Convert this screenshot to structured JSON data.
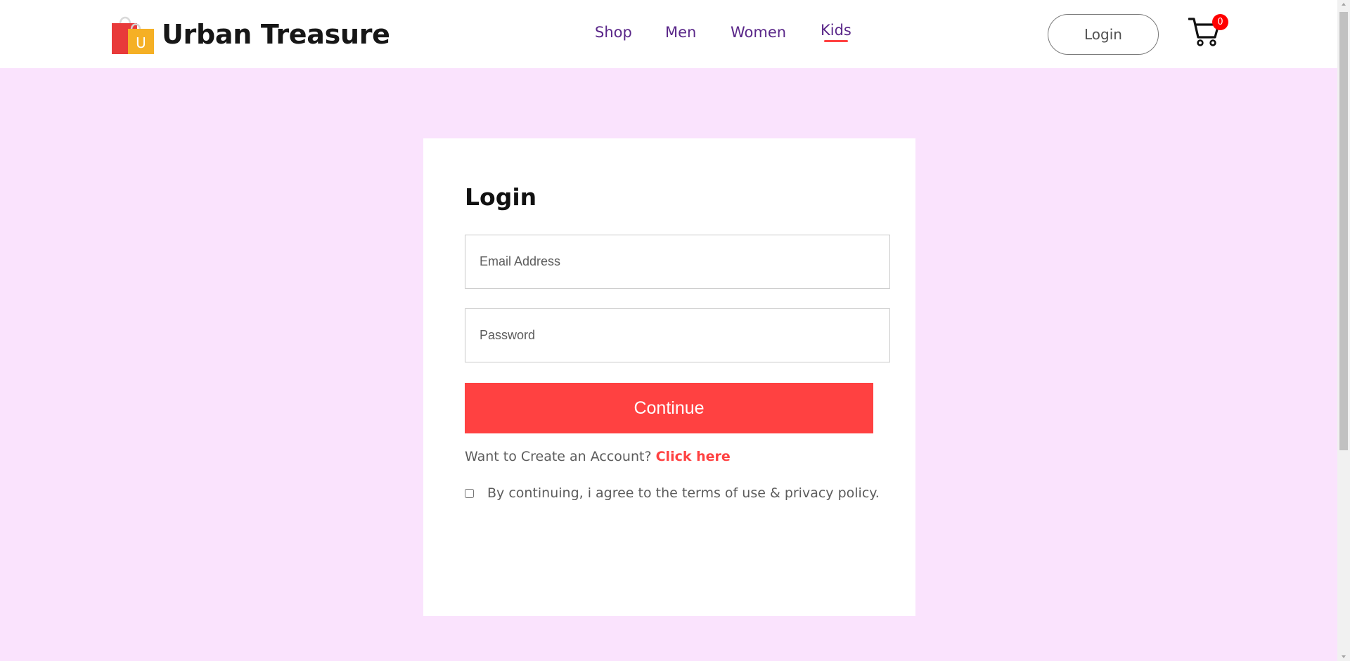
{
  "brand": {
    "name": "Urban Treasure",
    "logo_icon": "shopping-bags-icon",
    "logo_letter": "U"
  },
  "nav": {
    "items": [
      {
        "label": "Shop",
        "active": false
      },
      {
        "label": "Men",
        "active": false
      },
      {
        "label": "Women",
        "active": false
      },
      {
        "label": "Kids",
        "active": true
      }
    ]
  },
  "header": {
    "login_label": "Login",
    "cart_icon": "cart-icon",
    "cart_count": "0"
  },
  "login_form": {
    "title": "Login",
    "email_placeholder": "Email Address",
    "password_placeholder": "Password",
    "continue_label": "Continue",
    "signup_prompt": "Want to Create an Account?",
    "signup_link": "Click here",
    "agree_text": "By continuing, i agree to the terms of use & privacy policy.",
    "agree_checked": false
  },
  "colors": {
    "accent": "#ff4141",
    "nav_text": "#5a2789",
    "page_background": "#fae3fd",
    "card_background": "#ffffff",
    "badge": "#ff0000"
  }
}
